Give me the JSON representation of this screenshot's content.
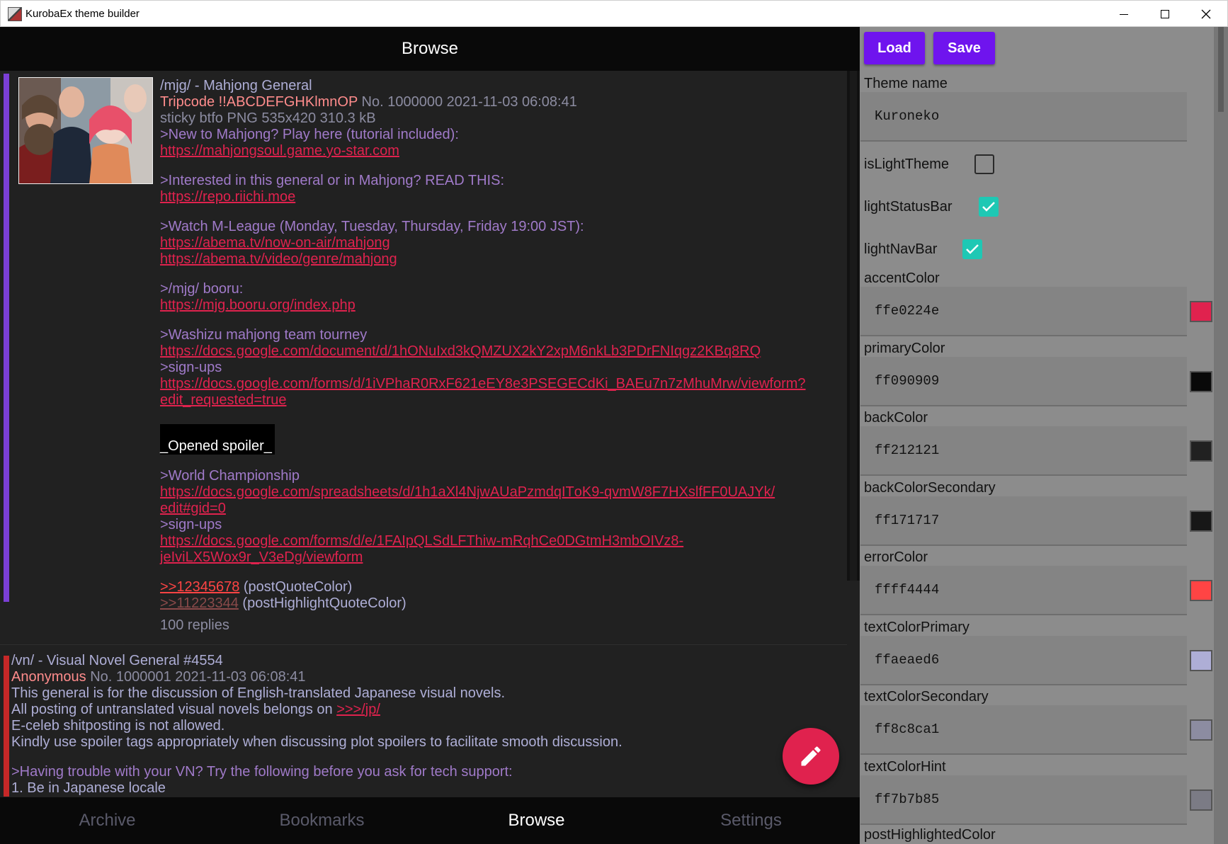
{
  "window": {
    "title": "KurobaEx theme builder"
  },
  "left": {
    "topbar_title": "Browse",
    "post1": {
      "title": "/mjg/ - Mahjong General",
      "name": "Tripcode !!ABCDEFGHKlmnOP",
      "number_date": "No. 1000000 2021-11-03 06:08:41",
      "file_info": "sticky btfo PNG 535x420 310.3 kB",
      "lines": {
        "q1": ">New to Mahjong? Play here (tutorial included):",
        "l1": "https://mahjongsoul.game.yo-star.com",
        "q2": ">Interested in this general or in Mahjong? READ THIS:",
        "l2": "https://repo.riichi.moe",
        "q3": ">Watch M-League (Monday, Tuesday, Thursday, Friday 19:00 JST):",
        "l3a": "https://abema.tv/now-on-air/mahjong",
        "l3b": "https://abema.tv/video/genre/mahjong",
        "q4": ">/mjg/ booru:",
        "l4": "https://mjg.booru.org/index.php",
        "q5": ">Washizu mahjong team tourney",
        "l5": "https://docs.google.com/document/d/1hONuIxd3kQMZUX2kY2xpM6nkLb3PDrFNIqgz2KBq8RQ",
        "q6": ">sign-ups",
        "l6a": "https://docs.google.com/forms/d/1iVPhaR0RxF621eEY8e3PSEGECdKi_BAEu7n7zMhuMrw/viewform?",
        "l6b": "edit_requested=true",
        "spoiler": "_Opened spoiler_",
        "q7": ">World Championship",
        "l7a": "https://docs.google.com/spreadsheets/d/1h1aXl4NjwAUaPzmdqITοK9-qvmW8F7HXslfFF0UAJYk/",
        "l7b": "edit#gid=0",
        "q8": ">sign-ups",
        "l8a": "https://docs.google.com/forms/d/e/1FAIpQLSdLFThiw-mRqhCe0DGtmH3mbOIVz8-",
        "l8b": "jeIviLX5Wox9r_V3eDg/viewform",
        "pq": ">>12345678",
        "pq_label": " (postQuoteColor)",
        "phq": ">>11223344",
        "phq_label": " (postHighlightQuoteColor)"
      },
      "replies": "100 replies"
    },
    "post2": {
      "title": "/vn/ - Visual Novel General #4554",
      "name": "Anonymous",
      "number_date": "No. 1000001 2021-11-03 06:08:41",
      "t1": "This general is for the discussion of English-translated Japanese visual novels.",
      "t2": "All posting of untranslated visual novels belongs on ",
      "t2_link": ">>>/jp/",
      "t3": "E-celeb shitposting is not allowed.",
      "t4": "Kindly use spoiler tags appropriately when discussing plot spoilers to facilitate smooth discussion.",
      "q1": ">Having trouble with your VN? Try the following before you ask for tech support:",
      "t5": "1. Be in Japanese locale"
    },
    "nav": {
      "archive": "Archive",
      "bookmarks": "Bookmarks",
      "browse": "Browse",
      "settings": "Settings",
      "active": "Browse"
    }
  },
  "right": {
    "load_label": "Load",
    "save_label": "Save",
    "theme_name_label": "Theme name",
    "theme_name_value": "Kuroneko",
    "toggles": [
      {
        "label": "isLightTheme",
        "checked": false
      },
      {
        "label": "lightStatusBar",
        "checked": true
      },
      {
        "label": "lightNavBar",
        "checked": true
      }
    ],
    "colors": [
      {
        "label": "accentColor",
        "value": "ffe0224e",
        "swatch": "#e0224e"
      },
      {
        "label": "primaryColor",
        "value": "ff090909",
        "swatch": "#090909"
      },
      {
        "label": "backColor",
        "value": "ff212121",
        "swatch": "#212121"
      },
      {
        "label": "backColorSecondary",
        "value": "ff171717",
        "swatch": "#171717"
      },
      {
        "label": "errorColor",
        "value": "ffff4444",
        "swatch": "#ff4444"
      },
      {
        "label": "textColorPrimary",
        "value": "ffaeaed6",
        "swatch": "#aeaed6"
      },
      {
        "label": "textColorSecondary",
        "value": "ff8c8ca1",
        "swatch": "#8c8ca1"
      },
      {
        "label": "textColorHint",
        "value": "ff7b7b85",
        "swatch": "#7b7b85"
      }
    ],
    "last_label": "postHighlightedColor"
  },
  "colors": {
    "accent": "#e0224e",
    "button": "#6f14ee",
    "check": "#1ec8b4",
    "post1_stripe": "#7b3fd6",
    "post2_stripe": "#c62828"
  }
}
